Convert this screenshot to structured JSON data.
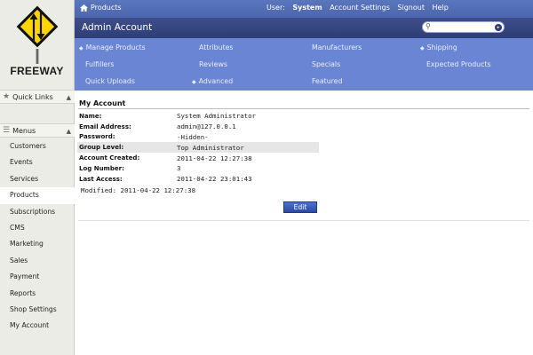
{
  "brand": {
    "name": "FREEWAY",
    "tagline": ""
  },
  "sidebar": {
    "quick_links_label": "Quick Links",
    "menus_label": "Menus",
    "items": [
      {
        "label": "Customers"
      },
      {
        "label": "Events"
      },
      {
        "label": "Services"
      },
      {
        "label": "Products",
        "active": true
      },
      {
        "label": "Subscriptions"
      },
      {
        "label": "CMS"
      },
      {
        "label": "Marketing"
      },
      {
        "label": "Sales"
      },
      {
        "label": "Payment"
      },
      {
        "label": "Reports"
      },
      {
        "label": "Shop Settings"
      },
      {
        "label": "My Account"
      }
    ]
  },
  "header": {
    "home_label": "Products",
    "user_prefix": "User:",
    "user_name": "System",
    "account_settings": "Account Settings",
    "signout": "Signout",
    "help": "Help",
    "page_title": "Admin Account",
    "search_placeholder": ""
  },
  "nav": {
    "manage_products": "Manage Products",
    "attributes": "Attributes",
    "manufacturers": "Manufacturers",
    "shipping": "Shipping",
    "fulfillers": "Fulfillers",
    "reviews": "Reviews",
    "specials": "Specials",
    "expected_products": "Expected Products",
    "quick_uploads": "Quick Uploads",
    "advanced": "Advanced",
    "featured": "Featured"
  },
  "account": {
    "section_title": "My Account",
    "rows": [
      {
        "label": "Name:",
        "value": "System Administrator"
      },
      {
        "label": "Email Address:",
        "value": "admin@127.0.0.1"
      },
      {
        "label": "Password:",
        "value": "-Hidden-"
      },
      {
        "label": "Group Level:",
        "value": "Top Administrator"
      },
      {
        "label": "Account Created:",
        "value": "2011-04-22 12:27:38"
      },
      {
        "label": "Log Number:",
        "value": "3"
      },
      {
        "label": "Last Access:",
        "value": "2011-04-22 23:01:43"
      }
    ],
    "modified": "Modified: 2011-04-22 12:27:38",
    "edit_label": "Edit"
  },
  "colors": {
    "topbar": "#4f6bb2",
    "titlebar": "#34447f",
    "navpanel": "#6a85d4",
    "edit_button": "#3a5cbc",
    "sidebar_bg": "#ecece6"
  }
}
